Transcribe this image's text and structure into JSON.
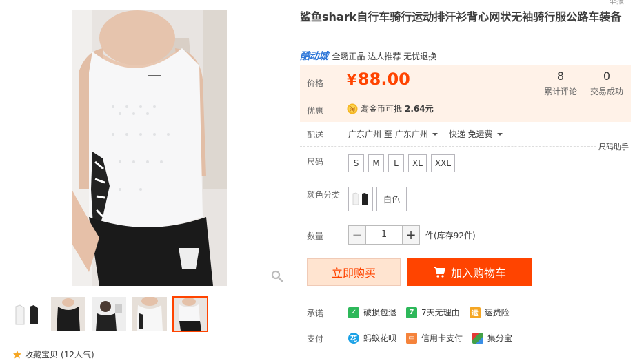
{
  "product": {
    "title": "鲨鱼shark自行车骑行运动排汗衫背心网状无袖骑行服公路车装备",
    "top_cut_text": "举报"
  },
  "brand": {
    "logo_text": "酷动城",
    "tags": "全场正品 达人推荐 无忧退换"
  },
  "price": {
    "label": "价格",
    "currency": "¥",
    "amount": "88.00",
    "reviews_count": "8",
    "reviews_label": "累计评论",
    "deals_count": "0",
    "deals_label": "交易成功"
  },
  "promo": {
    "label": "优惠",
    "icon": "taojinbi-icon",
    "text": "淘金币可抵",
    "value": "2.64元"
  },
  "delivery": {
    "label": "配送",
    "route": "广东广州 至",
    "destination": "广东广州",
    "method": "快递 免运费"
  },
  "size": {
    "label": "尺码",
    "help": "尺码助手",
    "options": [
      "S",
      "M",
      "L",
      "XL",
      "XXL"
    ]
  },
  "color": {
    "label": "颜色分类",
    "text_option": "白色"
  },
  "quantity": {
    "label": "数量",
    "value": "1",
    "minus": "−",
    "plus": "+",
    "stock": "件(库存92件)"
  },
  "actions": {
    "buy_now": "立即购买",
    "add_to_cart": "加入购物车"
  },
  "promise": {
    "label": "承诺",
    "items": [
      {
        "icon": "shield-icon",
        "text": "破损包退",
        "color": "#2db85a"
      },
      {
        "icon": "seven-days-icon",
        "text": "7天无理由",
        "color": "#2db85a"
      },
      {
        "icon": "shipping-insurance-icon",
        "text": "运费险",
        "color": "#f5a623"
      }
    ]
  },
  "payment": {
    "label": "支付",
    "items": [
      {
        "icon": "huabei-icon",
        "text": "蚂蚁花呗",
        "color": "#1aa1e6"
      },
      {
        "icon": "credit-card-icon",
        "text": "信用卡支付",
        "color": "#f5833b"
      },
      {
        "icon": "jifenbao-icon",
        "text": "集分宝",
        "color": "#3a8ee6"
      }
    ]
  },
  "favorite": {
    "text": "收藏宝贝",
    "count": "(12人气)"
  },
  "colors": {
    "accent": "#ff4400",
    "price_bg": "#fff2e8"
  }
}
